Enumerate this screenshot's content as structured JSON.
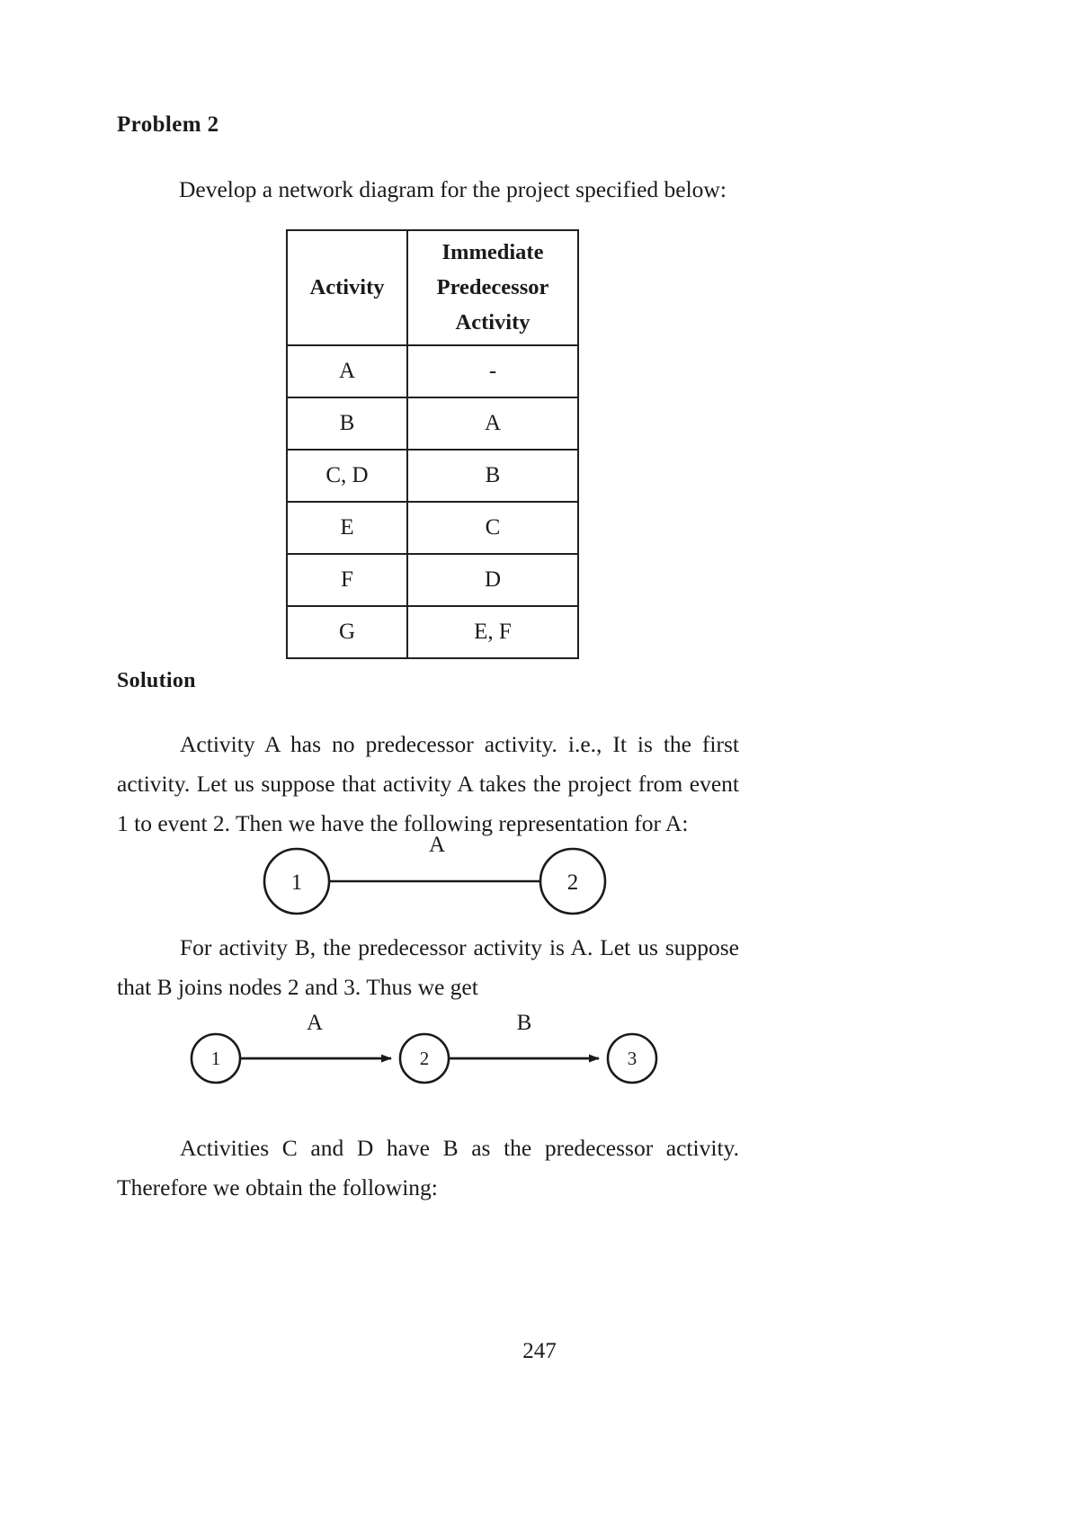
{
  "document": {
    "problem_heading": "Problem  2",
    "intro": "Develop a network diagram for the project specified below:",
    "solution_heading": "Solution",
    "page_number": "247"
  },
  "table": {
    "headers": [
      "Activity",
      "Immediate Predecessor Activity"
    ],
    "header_left": "Activity",
    "header_right_line1": "Immediate",
    "header_right_line2": "Predecessor",
    "header_right_line3": "Activity",
    "rows": [
      {
        "activity": "A",
        "predecessor": "-"
      },
      {
        "activity": "B",
        "predecessor": "A"
      },
      {
        "activity": "C, D",
        "predecessor": "B"
      },
      {
        "activity": "E",
        "predecessor": "C"
      },
      {
        "activity": "F",
        "predecessor": "D"
      },
      {
        "activity": "G",
        "predecessor": "E, F"
      }
    ]
  },
  "paragraphs": {
    "p1": "Activity A has no predecessor activity. i.e., It is the first activity. Let us suppose that activity A takes the project from event 1 to event 2. Then we have the following representation for A:",
    "p2": "For activity B, the predecessor activity is A. Let us suppose that B joins nodes 2 and 3. Thus we get",
    "p3": "Activities C and D have B as the predecessor activity. Therefore we obtain the following:"
  },
  "diagram_1": {
    "nodes": [
      "1",
      "2"
    ],
    "edges": [
      {
        "label": "A",
        "from": "1",
        "to": "2"
      }
    ]
  },
  "diagram_2": {
    "nodes": [
      "1",
      "2",
      "3"
    ],
    "edges": [
      {
        "label": "A",
        "from": "1",
        "to": "2"
      },
      {
        "label": "B",
        "from": "2",
        "to": "3"
      }
    ]
  },
  "colors": {
    "ink": "#1a1a1a",
    "rule": "#231f20",
    "paper": "#ffffff"
  }
}
